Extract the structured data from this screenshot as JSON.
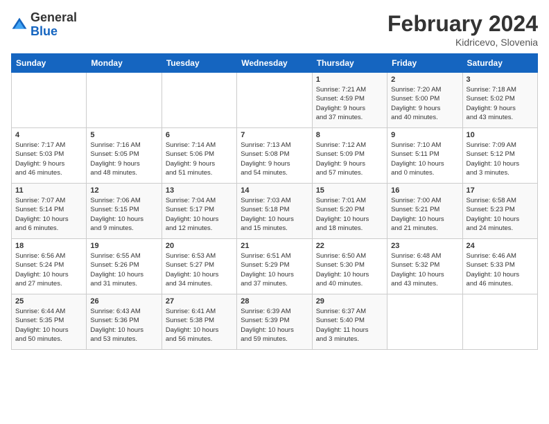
{
  "logo": {
    "general": "General",
    "blue": "Blue"
  },
  "header": {
    "title": "February 2024",
    "subtitle": "Kidricevo, Slovenia"
  },
  "weekdays": [
    "Sunday",
    "Monday",
    "Tuesday",
    "Wednesday",
    "Thursday",
    "Friday",
    "Saturday"
  ],
  "weeks": [
    [
      {
        "day": "",
        "info": ""
      },
      {
        "day": "",
        "info": ""
      },
      {
        "day": "",
        "info": ""
      },
      {
        "day": "",
        "info": ""
      },
      {
        "day": "1",
        "info": "Sunrise: 7:21 AM\nSunset: 4:59 PM\nDaylight: 9 hours\nand 37 minutes."
      },
      {
        "day": "2",
        "info": "Sunrise: 7:20 AM\nSunset: 5:00 PM\nDaylight: 9 hours\nand 40 minutes."
      },
      {
        "day": "3",
        "info": "Sunrise: 7:18 AM\nSunset: 5:02 PM\nDaylight: 9 hours\nand 43 minutes."
      }
    ],
    [
      {
        "day": "4",
        "info": "Sunrise: 7:17 AM\nSunset: 5:03 PM\nDaylight: 9 hours\nand 46 minutes."
      },
      {
        "day": "5",
        "info": "Sunrise: 7:16 AM\nSunset: 5:05 PM\nDaylight: 9 hours\nand 48 minutes."
      },
      {
        "day": "6",
        "info": "Sunrise: 7:14 AM\nSunset: 5:06 PM\nDaylight: 9 hours\nand 51 minutes."
      },
      {
        "day": "7",
        "info": "Sunrise: 7:13 AM\nSunset: 5:08 PM\nDaylight: 9 hours\nand 54 minutes."
      },
      {
        "day": "8",
        "info": "Sunrise: 7:12 AM\nSunset: 5:09 PM\nDaylight: 9 hours\nand 57 minutes."
      },
      {
        "day": "9",
        "info": "Sunrise: 7:10 AM\nSunset: 5:11 PM\nDaylight: 10 hours\nand 0 minutes."
      },
      {
        "day": "10",
        "info": "Sunrise: 7:09 AM\nSunset: 5:12 PM\nDaylight: 10 hours\nand 3 minutes."
      }
    ],
    [
      {
        "day": "11",
        "info": "Sunrise: 7:07 AM\nSunset: 5:14 PM\nDaylight: 10 hours\nand 6 minutes."
      },
      {
        "day": "12",
        "info": "Sunrise: 7:06 AM\nSunset: 5:15 PM\nDaylight: 10 hours\nand 9 minutes."
      },
      {
        "day": "13",
        "info": "Sunrise: 7:04 AM\nSunset: 5:17 PM\nDaylight: 10 hours\nand 12 minutes."
      },
      {
        "day": "14",
        "info": "Sunrise: 7:03 AM\nSunset: 5:18 PM\nDaylight: 10 hours\nand 15 minutes."
      },
      {
        "day": "15",
        "info": "Sunrise: 7:01 AM\nSunset: 5:20 PM\nDaylight: 10 hours\nand 18 minutes."
      },
      {
        "day": "16",
        "info": "Sunrise: 7:00 AM\nSunset: 5:21 PM\nDaylight: 10 hours\nand 21 minutes."
      },
      {
        "day": "17",
        "info": "Sunrise: 6:58 AM\nSunset: 5:23 PM\nDaylight: 10 hours\nand 24 minutes."
      }
    ],
    [
      {
        "day": "18",
        "info": "Sunrise: 6:56 AM\nSunset: 5:24 PM\nDaylight: 10 hours\nand 27 minutes."
      },
      {
        "day": "19",
        "info": "Sunrise: 6:55 AM\nSunset: 5:26 PM\nDaylight: 10 hours\nand 31 minutes."
      },
      {
        "day": "20",
        "info": "Sunrise: 6:53 AM\nSunset: 5:27 PM\nDaylight: 10 hours\nand 34 minutes."
      },
      {
        "day": "21",
        "info": "Sunrise: 6:51 AM\nSunset: 5:29 PM\nDaylight: 10 hours\nand 37 minutes."
      },
      {
        "day": "22",
        "info": "Sunrise: 6:50 AM\nSunset: 5:30 PM\nDaylight: 10 hours\nand 40 minutes."
      },
      {
        "day": "23",
        "info": "Sunrise: 6:48 AM\nSunset: 5:32 PM\nDaylight: 10 hours\nand 43 minutes."
      },
      {
        "day": "24",
        "info": "Sunrise: 6:46 AM\nSunset: 5:33 PM\nDaylight: 10 hours\nand 46 minutes."
      }
    ],
    [
      {
        "day": "25",
        "info": "Sunrise: 6:44 AM\nSunset: 5:35 PM\nDaylight: 10 hours\nand 50 minutes."
      },
      {
        "day": "26",
        "info": "Sunrise: 6:43 AM\nSunset: 5:36 PM\nDaylight: 10 hours\nand 53 minutes."
      },
      {
        "day": "27",
        "info": "Sunrise: 6:41 AM\nSunset: 5:38 PM\nDaylight: 10 hours\nand 56 minutes."
      },
      {
        "day": "28",
        "info": "Sunrise: 6:39 AM\nSunset: 5:39 PM\nDaylight: 10 hours\nand 59 minutes."
      },
      {
        "day": "29",
        "info": "Sunrise: 6:37 AM\nSunset: 5:40 PM\nDaylight: 11 hours\nand 3 minutes."
      },
      {
        "day": "",
        "info": ""
      },
      {
        "day": "",
        "info": ""
      }
    ]
  ]
}
